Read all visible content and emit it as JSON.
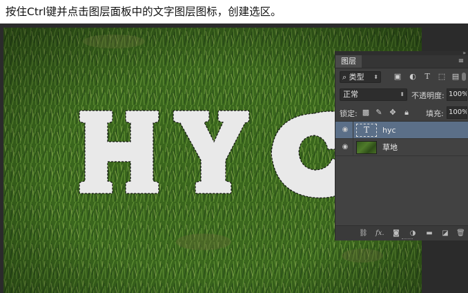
{
  "caption": "按住Ctrl键并点击图层面板中的文字图层图标，创建选区。",
  "canvas": {
    "text_layer_content": "HYC",
    "background_color": "#3d6a1f"
  },
  "panel": {
    "tab_label": "图层",
    "filter": {
      "kind_label": "⌕ 类型",
      "icons": [
        "image-filter-icon",
        "adjustment-filter-icon",
        "type-filter-icon",
        "shape-filter-icon",
        "smart-object-filter-icon"
      ]
    },
    "blend_mode": "正常",
    "opacity_label": "不透明度:",
    "opacity_value": "100%",
    "lock_label": "锁定:",
    "fill_label": "填充:",
    "fill_value": "100%",
    "layers": [
      {
        "name": "hyc",
        "type": "text",
        "thumb_glyph": "T",
        "selected": true,
        "visible": true
      },
      {
        "name": "草地",
        "type": "image",
        "selected": false,
        "visible": true
      }
    ],
    "bottom_icons": [
      "link-layers-icon",
      "fx-icon",
      "mask-icon",
      "adjustment-layer-icon",
      "group-folder-icon",
      "new-layer-icon",
      "trash-icon"
    ],
    "fx_label": "fx."
  },
  "colors": {
    "panel_bg": "#3f3f3f",
    "selected_layer": "#5b6f88",
    "workspace": "#2b2b2b",
    "text_fill": "#e9e9e9"
  }
}
